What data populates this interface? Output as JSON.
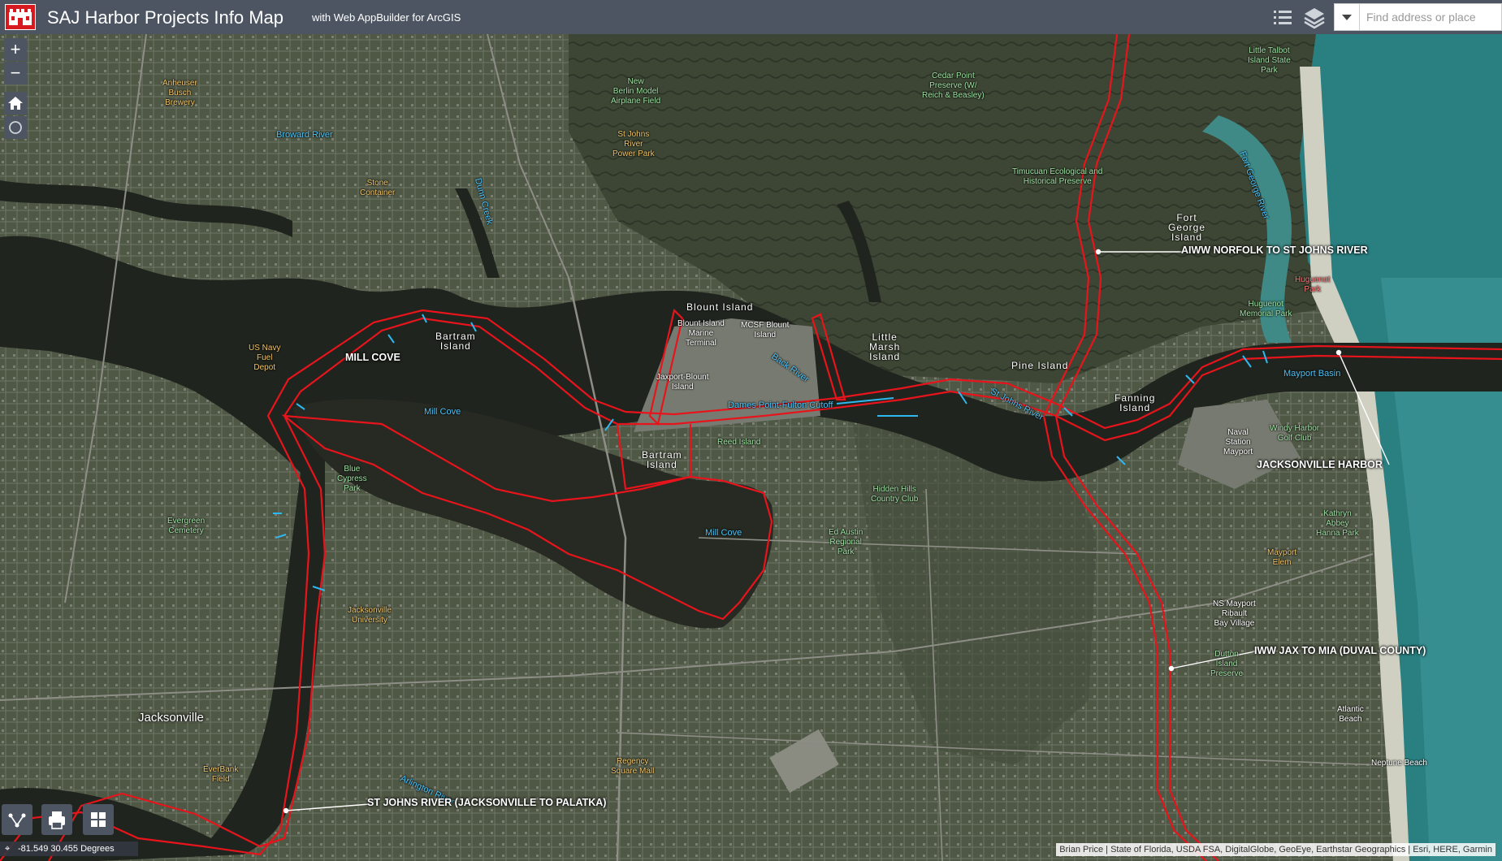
{
  "header": {
    "title": "SAJ Harbor Projects Info Map",
    "subtitle": "with Web AppBuilder for ArcGIS",
    "search_placeholder": "Find address or place",
    "icons": [
      "legend-list-icon",
      "layers-icon",
      "chevron-down-icon"
    ]
  },
  "colors": {
    "header_bg": "#4d5563",
    "channel_red": "#e8141c",
    "ocean": "#2a7f80",
    "land_green": "#a4e3a8",
    "label_yellow": "#f1c56a",
    "water_label_blue": "#4fc3f7"
  },
  "map_tools": {
    "zoom_in": "+",
    "zoom_out": "−",
    "icons": [
      "home-icon",
      "locate-icon",
      "measure-icon",
      "print-icon",
      "basemap-gallery-icon"
    ]
  },
  "labels": {
    "anheuser": "Anheuser\nBusch\nBrewery",
    "broward": "Broward River",
    "new_berlin": "New\nBerlin Model\nAirplane Field",
    "st_johns_power": "St Johns\nRiver\nPower Park",
    "stone_container": "Stone\nContainer",
    "dunn_creek": "Dunn Creek",
    "cedar_point": "Cedar Point\nPreserve (W/\nReich & Beasley)",
    "little_talbot": "Little Talbot\nIsland State\nPark",
    "timucuan": "Timucuan Ecological and\nHistorical Preserve",
    "fort_george_river": "Fort George River",
    "fort_george": "Fort\nGeorge\nIsland",
    "huguenot_park": "Huguenot\nPark",
    "huguenot_memorial": "Huguenot\nMemorial Park",
    "us_navy": "US Navy\nFuel\nDepot",
    "mill_cove_upper": "MILL COVE",
    "bartram_1": "Bartram\nIsland",
    "mill_cove_water": "Mill Cove",
    "blount_island": "Blount Island",
    "blount_marine": "Blount Island\nMarine\nTerminal",
    "mcsf": "MCSF Blount\nIsland",
    "jaxport": "Jaxport-Blount\nIsland",
    "back_river": "Back River",
    "little_marsh": "Little\nMarsh\nIsland",
    "dames_point": "Dames Point-Fulton Cutoff",
    "pine_island": "Pine Island",
    "st_johns_river": "St Johns River",
    "fanning": "Fanning\nIsland",
    "mayport_basin": "Mayport Basin",
    "naval_station": "Naval\nStation\nMayport",
    "windy_harbor": "Windy Harbor\nGolf Club",
    "bartram_2": "Bartram\nIsland",
    "reed_island": "Reed Island",
    "blue_cypress": "Blue\nCypress\nPark",
    "evergreen": "Evergreen\nCemetery",
    "mill_cove_lower": "Mill Cove",
    "hidden_hills": "Hidden Hills\nCountry Club",
    "ed_austin": "Ed Austin\nRegional\nPark",
    "kathryn_abbey": "Kathryn\nAbbey\nHanna Park",
    "mayport_elem": "Mayport\nElem",
    "ns_mayport": "NS Mayport\nRibault\nBay Village",
    "dutton": "Dutton\nIsland\nPreserve",
    "ju": "Jacksonville\nUniversity",
    "jacksonville": "Jacksonville",
    "everbank": "EverBank\nField",
    "arlington": "Arlington River",
    "regency": "Regency\nSquare Mall",
    "atlantic_beach": "Atlantic\nBeach",
    "neptune_beach": "Neptune Beach"
  },
  "projects": {
    "aiww": "AIWW NORFOLK TO ST JOHNS RIVER",
    "jax_harbor": "JACKSONVILLE HARBOR",
    "iww": "IWW JAX TO MIA (DUVAL COUNTY)",
    "sjr": "ST JOHNS RIVER (JACKSONVILLE TO PALATKA)"
  },
  "status": {
    "coordinates": "-81.549 30.455 Degrees",
    "attribution": "Brian Price | State of Florida, USDA FSA, DigitalGlobe, GeoEye, Earthstar Geographics | Esri, HERE, Garmin"
  }
}
